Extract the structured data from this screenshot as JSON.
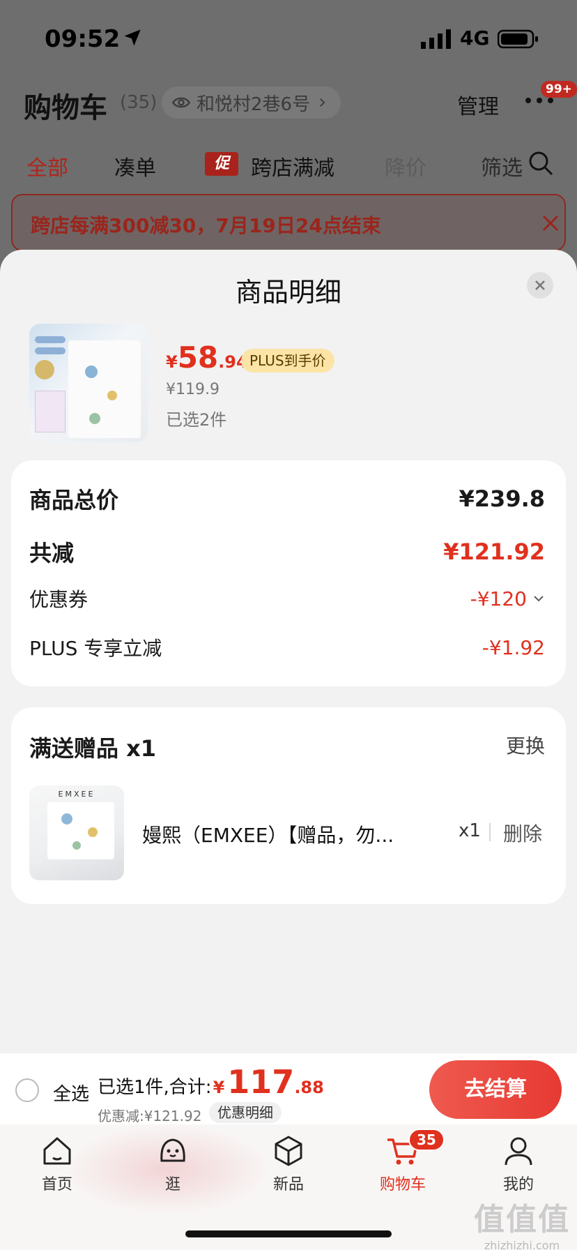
{
  "status_bar": {
    "time": "09:52",
    "network": "4G"
  },
  "page": {
    "title": "购物车",
    "count": "(35)",
    "address": "和悦村2巷6号",
    "manage": "管理",
    "notification_badge": "99+"
  },
  "tabs": [
    {
      "label": "全部"
    },
    {
      "label": "凑单"
    },
    {
      "label": "跨店满减",
      "tag": "促"
    },
    {
      "label": "降价"
    },
    {
      "label": "筛选"
    }
  ],
  "promo_banner": {
    "text": "跨店每满300减30，7月19日24点结束"
  },
  "sheet": {
    "title": "商品明细",
    "product": {
      "price_symbol": "¥",
      "price_int": "58",
      "price_dec": ".94",
      "plus_tag": "PLUS到手价",
      "original_price": "¥119.9",
      "selected": "已选2件"
    },
    "summary": {
      "total_label": "商品总价",
      "total_value": "¥239.8",
      "reduce_label": "共减",
      "reduce_value": "¥121.92",
      "coupon_label": "优惠券",
      "coupon_value": "-¥120",
      "plus_label": "PLUS 专享立减",
      "plus_value": "-¥1.92"
    },
    "gift": {
      "title": "满送赠品 x1",
      "change": "更换",
      "brand": "EMXEE",
      "name": "嫚熙（EMXEE）【赠品，勿...",
      "qty": "x1",
      "delete": "删除"
    }
  },
  "bottom_bar": {
    "select_all": "全选",
    "summary_label": "已选1件,合计:",
    "total_symbol": "¥",
    "total_int": "117",
    "total_dec": ".88",
    "discount": "优惠减:¥121.92",
    "detail": "优惠明细",
    "checkout": "去结算"
  },
  "tab_bar": {
    "items": [
      {
        "label": "首页",
        "icon": "home-icon"
      },
      {
        "label": "逛",
        "icon": "face-icon"
      },
      {
        "label": "新品",
        "icon": "box-icon"
      },
      {
        "label": "购物车",
        "icon": "cart-icon",
        "badge": "35"
      },
      {
        "label": "我的",
        "icon": "person-icon"
      }
    ]
  },
  "watermark": {
    "logo": "值值值",
    "url": "zhizhizhi.com"
  },
  "colors": {
    "accent_red": "#e0301e",
    "checkout_gradient_start": "#ef5a4f",
    "checkout_gradient_end": "#e63a33",
    "plus_tag_bg": "#fbe4a6"
  }
}
